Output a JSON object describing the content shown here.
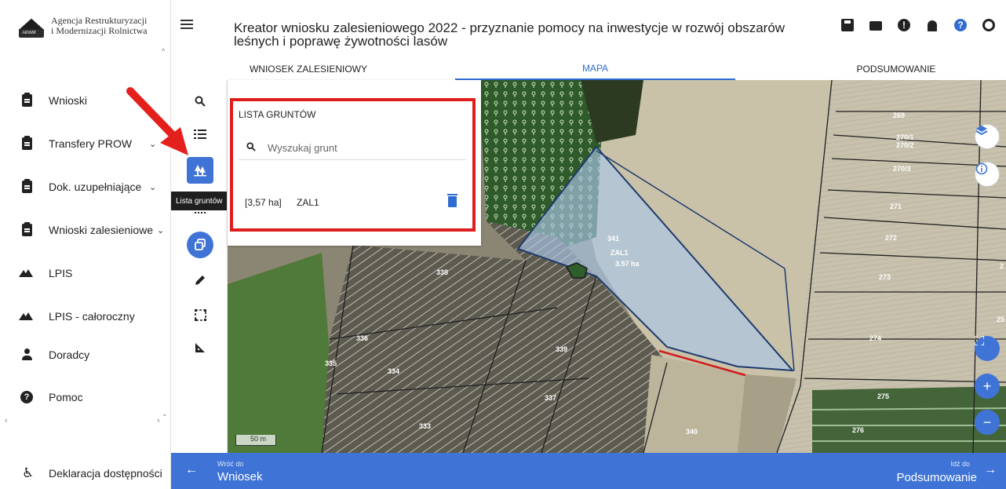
{
  "logo": {
    "line1": "Agencja Restrukturyzacji",
    "line2": "i Modernizacji Rolnictwa",
    "mark_text": "ARiMR"
  },
  "sidebar": {
    "items": [
      {
        "label": "Wnioski",
        "icon": "clipboard-icon"
      },
      {
        "label": "Transfery PROW",
        "icon": "clipboard-icon",
        "chevron": "⌄"
      },
      {
        "label": "Dok. uzupełniające",
        "icon": "clipboard-icon",
        "chevron": "⌄"
      },
      {
        "label": "Wnioski zalesieniowe",
        "icon": "clipboard-icon",
        "chevron": "⌄"
      },
      {
        "label": "LPIS",
        "icon": "mountain-icon"
      },
      {
        "label": "LPIS - całoroczny",
        "icon": "mountain-icon"
      },
      {
        "label": "Doradcy",
        "icon": "person-icon"
      },
      {
        "label": "Pomoc",
        "icon": "help-icon"
      }
    ],
    "accessibility": "Deklaracja dostępności"
  },
  "header": {
    "title": "Kreator wniosku zalesieniowego 2022 - przyznanie pomocy na inwestycje w rozwój obszarów leśnych i poprawę żywotności lasów",
    "tabs": [
      {
        "label": "WNIOSEK ZALESIENIOWY",
        "active": false
      },
      {
        "label": "MAPA",
        "active": true
      },
      {
        "label": "PODSUMOWANIE",
        "active": false
      }
    ],
    "icons": [
      "save-icon",
      "print-icon",
      "alert-icon",
      "bell-icon",
      "help-icon",
      "user-icon"
    ]
  },
  "tools": {
    "tooltip": "Lista gruntów",
    "items": [
      "search-icon",
      "list-icon",
      "trees-icon",
      "grid-icon",
      "copy-icon",
      "pencil-icon",
      "select-area-icon",
      "measure-icon"
    ]
  },
  "panel": {
    "title": "LISTA GRUNTÓW",
    "search_placeholder": "Wyszukaj grunt",
    "rows": [
      {
        "area": "[3,57 ha]",
        "name": "ZAL1"
      }
    ]
  },
  "map": {
    "parcels": [
      "269",
      "270/1",
      "270/2",
      "270/3",
      "271",
      "272",
      "273",
      "274",
      "275",
      "276",
      "341",
      "338",
      "339",
      "336",
      "335",
      "334",
      "337",
      "333",
      "340",
      "25",
      "2"
    ],
    "selected_label": "ZAL1",
    "selected_area": "3.57 ha",
    "scale": "50 m"
  },
  "bottom": {
    "back_small": "Wróć do",
    "back_big": "Wniosek",
    "next_small": "Idź do",
    "next_big": "Podsumowanie"
  },
  "colors": {
    "accent": "#3f74d6",
    "highlight": "#e01d1d"
  }
}
